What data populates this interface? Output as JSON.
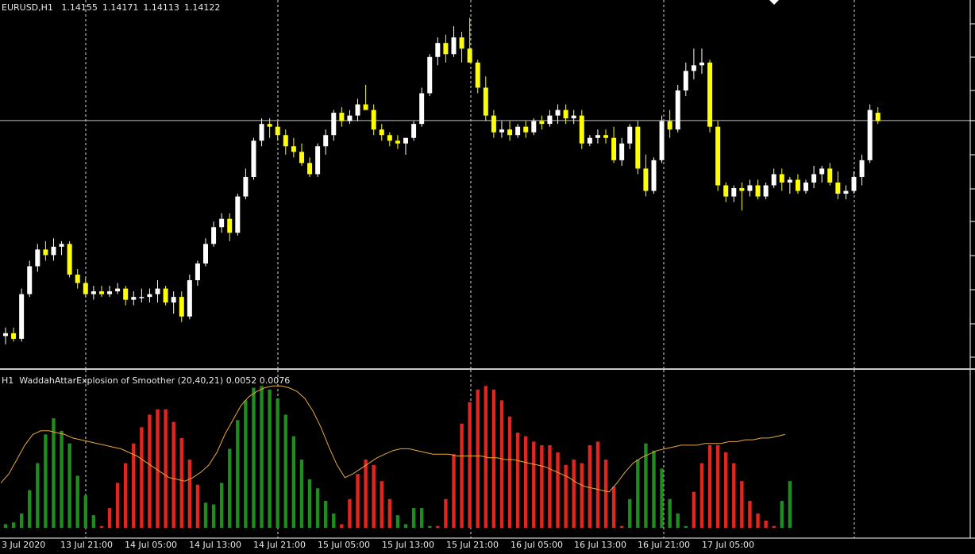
{
  "window": {
    "symbol": "EURUSD,H1",
    "open": "1.14155",
    "high": "1.14171",
    "low": "1.14113",
    "close": "1.14122"
  },
  "indicator": {
    "timeframe": "H1",
    "name": "WaddahAttarExplosion of Smoother (20,40,21)",
    "value1": "0.0052",
    "value2": "0.0076"
  },
  "colors": {
    "background": "#000000",
    "bull_candle": "#ffffff",
    "bear_candle": "#ffff00",
    "histogram_up": "#1e8c1e",
    "histogram_down": "#e0261e",
    "signal_line": "#e6a93a",
    "grid": "#ffffff",
    "bid_line": "#c0c0c0"
  },
  "time_axis": [
    "3 Jul 2020",
    "13 Jul 21:00",
    "14 Jul 05:00",
    "14 Jul 13:00",
    "14 Jul 21:00",
    "15 Jul 05:00",
    "15 Jul 13:00",
    "15 Jul 21:00",
    "16 Jul 05:00",
    "16 Jul 13:00",
    "16 Jul 21:00",
    "17 Jul 05:00"
  ],
  "chart_data": [
    {
      "type": "candlestick",
      "title": "EURUSD,H1",
      "grid": true,
      "bid_line": 1.14122,
      "ylim": [
        1.1326,
        1.1452
      ],
      "candles": [
        [
          1.1335,
          1.1338,
          1.1332,
          1.1336
        ],
        [
          1.1336,
          1.1338,
          1.1333,
          1.1334
        ],
        [
          1.1334,
          1.1352,
          1.1333,
          1.135
        ],
        [
          1.135,
          1.1362,
          1.1349,
          1.136
        ],
        [
          1.136,
          1.1368,
          1.1358,
          1.1366
        ],
        [
          1.1366,
          1.1369,
          1.1362,
          1.1364
        ],
        [
          1.1364,
          1.137,
          1.1362,
          1.1367
        ],
        [
          1.1367,
          1.1369,
          1.1364,
          1.1368
        ],
        [
          1.1368,
          1.1369,
          1.1356,
          1.1357
        ],
        [
          1.1357,
          1.1359,
          1.1352,
          1.1354
        ],
        [
          1.1354,
          1.1356,
          1.1349,
          1.135
        ],
        [
          1.135,
          1.1353,
          1.1348,
          1.1351
        ],
        [
          1.1351,
          1.1353,
          1.1349,
          1.135
        ],
        [
          1.135,
          1.1353,
          1.1349,
          1.1351
        ],
        [
          1.1351,
          1.1354,
          1.135,
          1.1352
        ],
        [
          1.1352,
          1.1353,
          1.1346,
          1.1348
        ],
        [
          1.1348,
          1.1351,
          1.1346,
          1.1349
        ],
        [
          1.1349,
          1.1352,
          1.1347,
          1.1349
        ],
        [
          1.1349,
          1.1352,
          1.1347,
          1.135
        ],
        [
          1.135,
          1.1355,
          1.1347,
          1.1352
        ],
        [
          1.1352,
          1.1353,
          1.1346,
          1.1347
        ],
        [
          1.1347,
          1.1351,
          1.1343,
          1.1349
        ],
        [
          1.1349,
          1.1351,
          1.134,
          1.1342
        ],
        [
          1.1342,
          1.1357,
          1.1341,
          1.1355
        ],
        [
          1.1355,
          1.1362,
          1.1353,
          1.1361
        ],
        [
          1.1361,
          1.137,
          1.136,
          1.1368
        ],
        [
          1.1368,
          1.1376,
          1.1367,
          1.1374
        ],
        [
          1.1374,
          1.1379,
          1.1372,
          1.1377
        ],
        [
          1.1377,
          1.1379,
          1.1369,
          1.1372
        ],
        [
          1.1372,
          1.1386,
          1.1371,
          1.1385
        ],
        [
          1.1385,
          1.1395,
          1.1384,
          1.1392
        ],
        [
          1.1392,
          1.1406,
          1.1391,
          1.1405
        ],
        [
          1.1405,
          1.1413,
          1.1403,
          1.1411
        ],
        [
          1.1411,
          1.1413,
          1.1406,
          1.141
        ],
        [
          1.141,
          1.1412,
          1.1405,
          1.1407
        ],
        [
          1.1407,
          1.1409,
          1.14,
          1.1403
        ],
        [
          1.1403,
          1.1406,
          1.1399,
          1.1401
        ],
        [
          1.1401,
          1.1404,
          1.1396,
          1.1397
        ],
        [
          1.1397,
          1.1399,
          1.1392,
          1.1393
        ],
        [
          1.1393,
          1.1404,
          1.1392,
          1.1403
        ],
        [
          1.1403,
          1.1409,
          1.14,
          1.1407
        ],
        [
          1.1407,
          1.1416,
          1.1405,
          1.1415
        ],
        [
          1.1415,
          1.1417,
          1.141,
          1.1412
        ],
        [
          1.1412,
          1.1416,
          1.1411,
          1.1414
        ],
        [
          1.1414,
          1.142,
          1.1412,
          1.1418
        ],
        [
          1.1418,
          1.1425,
          1.1416,
          1.1416
        ],
        [
          1.1416,
          1.1418,
          1.1407,
          1.1409
        ],
        [
          1.1409,
          1.1411,
          1.1405,
          1.1407
        ],
        [
          1.1407,
          1.1408,
          1.1403,
          1.1405
        ],
        [
          1.1405,
          1.1407,
          1.1402,
          1.1404
        ],
        [
          1.1404,
          1.1406,
          1.14,
          1.1406
        ],
        [
          1.1406,
          1.1412,
          1.1405,
          1.1411
        ],
        [
          1.1411,
          1.1424,
          1.141,
          1.1422
        ],
        [
          1.1422,
          1.1436,
          1.1421,
          1.1435
        ],
        [
          1.1435,
          1.1442,
          1.1432,
          1.144
        ],
        [
          1.144,
          1.1443,
          1.1433,
          1.1436
        ],
        [
          1.1436,
          1.1446,
          1.1435,
          1.1442
        ],
        [
          1.1442,
          1.1444,
          1.1433,
          1.1438
        ],
        [
          1.1438,
          1.1449,
          1.1434,
          1.1433
        ],
        [
          1.1433,
          1.1434,
          1.1422,
          1.1424
        ],
        [
          1.1424,
          1.1428,
          1.1412,
          1.1414
        ],
        [
          1.1414,
          1.1416,
          1.1406,
          1.1408
        ],
        [
          1.1408,
          1.1412,
          1.1406,
          1.1409
        ],
        [
          1.1409,
          1.1412,
          1.1405,
          1.1407
        ],
        [
          1.1407,
          1.1411,
          1.1406,
          1.141
        ],
        [
          1.141,
          1.1412,
          1.1406,
          1.1408
        ],
        [
          1.1408,
          1.1413,
          1.1407,
          1.1412
        ],
        [
          1.1412,
          1.1414,
          1.1409,
          1.1411
        ],
        [
          1.1411,
          1.1416,
          1.141,
          1.1414
        ],
        [
          1.1414,
          1.1418,
          1.1411,
          1.1416
        ],
        [
          1.1416,
          1.1418,
          1.1411,
          1.1413
        ],
        [
          1.1413,
          1.1416,
          1.1411,
          1.1414
        ],
        [
          1.1414,
          1.1416,
          1.1402,
          1.1404
        ],
        [
          1.1404,
          1.1407,
          1.1403,
          1.1406
        ],
        [
          1.1406,
          1.1409,
          1.1404,
          1.1407
        ],
        [
          1.1407,
          1.1409,
          1.1404,
          1.1406
        ],
        [
          1.1406,
          1.141,
          1.1397,
          1.1398
        ],
        [
          1.1398,
          1.1406,
          1.1396,
          1.1404
        ],
        [
          1.1404,
          1.1411,
          1.1402,
          1.141
        ],
        [
          1.141,
          1.1412,
          1.1393,
          1.1395
        ],
        [
          1.1395,
          1.14,
          1.1385,
          1.1387
        ],
        [
          1.1387,
          1.1399,
          1.1386,
          1.1398
        ],
        [
          1.1398,
          1.1414,
          1.1397,
          1.1412
        ],
        [
          1.1412,
          1.1416,
          1.1406,
          1.1409
        ],
        [
          1.1409,
          1.1425,
          1.1408,
          1.1423
        ],
        [
          1.1423,
          1.1433,
          1.1421,
          1.143
        ],
        [
          1.143,
          1.1438,
          1.1427,
          1.1432
        ],
        [
          1.1432,
          1.1438,
          1.1429,
          1.1433
        ],
        [
          1.1433,
          1.1434,
          1.1408,
          1.141
        ],
        [
          1.141,
          1.1412,
          1.1387,
          1.1389
        ],
        [
          1.1389,
          1.139,
          1.1383,
          1.1385
        ],
        [
          1.1385,
          1.1389,
          1.1383,
          1.1388
        ],
        [
          1.1388,
          1.139,
          1.138,
          1.1387
        ],
        [
          1.1387,
          1.1391,
          1.1385,
          1.1389
        ],
        [
          1.1389,
          1.1391,
          1.1384,
          1.1385
        ],
        [
          1.1385,
          1.139,
          1.1384,
          1.1389
        ],
        [
          1.1389,
          1.1395,
          1.1388,
          1.1393
        ],
        [
          1.1393,
          1.1395,
          1.1387,
          1.139
        ],
        [
          1.139,
          1.1392,
          1.1386,
          1.1391
        ],
        [
          1.1391,
          1.1393,
          1.1386,
          1.1387
        ],
        [
          1.1387,
          1.1391,
          1.1386,
          1.139
        ],
        [
          1.139,
          1.1396,
          1.1388,
          1.1393
        ],
        [
          1.1393,
          1.1396,
          1.139,
          1.1395
        ],
        [
          1.1395,
          1.1397,
          1.1389,
          1.139
        ],
        [
          1.139,
          1.1394,
          1.1384,
          1.1386
        ],
        [
          1.1386,
          1.1389,
          1.1384,
          1.1387
        ],
        [
          1.1387,
          1.1394,
          1.1386,
          1.1392
        ],
        [
          1.1392,
          1.14,
          1.1389,
          1.1398
        ],
        [
          1.1398,
          1.1418,
          1.1397,
          1.1416
        ],
        [
          1.1415,
          1.1417,
          1.1411,
          1.1412
        ]
      ]
    },
    {
      "type": "bar",
      "title": "WaddahAttarExplosion of Smoother (20,40,21)",
      "series": [
        {
          "values": [
            0.0002,
            0.0003,
            0.0008,
            0.0021,
            0.0036,
            0.0052,
            0.0061,
            0.0054,
            0.0047,
            0.0029,
            0.0018,
            0.0007,
            0.0001,
            0.0011,
            0.0025,
            0.0036,
            0.0047,
            0.0056,
            0.0063,
            0.0066,
            0.0066,
            0.0059,
            0.005,
            0.0038,
            0.0024,
            0.0014,
            0.0013,
            0.0025,
            0.0044,
            0.006,
            0.0071,
            0.0078,
            0.0079,
            0.0077,
            0.0072,
            0.0063,
            0.0051,
            0.0038,
            0.0027,
            0.0022,
            0.0015,
            0.0008,
            0.0002,
            0.0016,
            0.003,
            0.0038,
            0.0035,
            0.0026,
            0.0016,
            0.0007,
            0.0002,
            0.0011,
            0.0011,
            0.0001,
            0.0001,
            0.0016,
            0.0041,
            0.0058,
            0.007,
            0.0077,
            0.0079,
            0.0077,
            0.0071,
            0.0062,
            0.0053,
            0.0051,
            0.0048,
            0.0046,
            0.0046,
            0.0042,
            0.0035,
            0.0038,
            0.0036,
            0.0046,
            0.0048,
            0.0038,
            0.0023,
            0.0001,
            0.0016,
            0.0038,
            0.0047,
            0.0043,
            0.0033,
            0.0016,
            0.0008,
            0.0001,
            0.002,
            0.0036,
            0.0046,
            0.0046,
            0.0042,
            0.0036,
            0.0026,
            0.0015,
            0.0008,
            0.0004,
            0.0001,
            0.0015,
            0.0026
          ],
          "colors": [
            "g",
            "g",
            "g",
            "g",
            "g",
            "g",
            "g",
            "g",
            "g",
            "g",
            "g",
            "g",
            "r",
            "r",
            "r",
            "r",
            "r",
            "r",
            "r",
            "r",
            "r",
            "r",
            "r",
            "r",
            "r",
            "g",
            "g",
            "g",
            "g",
            "g",
            "g",
            "g",
            "g",
            "g",
            "g",
            "g",
            "g",
            "g",
            "g",
            "g",
            "g",
            "g",
            "r",
            "r",
            "r",
            "r",
            "r",
            "r",
            "r",
            "g",
            "g",
            "g",
            "g",
            "g",
            "r",
            "r",
            "r",
            "r",
            "r",
            "r",
            "r",
            "r",
            "r",
            "r",
            "r",
            "r",
            "r",
            "r",
            "r",
            "r",
            "r",
            "r",
            "r",
            "r",
            "r",
            "r",
            "r",
            "r",
            "g",
            "g",
            "g",
            "g",
            "g",
            "g",
            "g",
            "g",
            "r",
            "r",
            "r",
            "r",
            "r",
            "r",
            "r",
            "r",
            "r",
            "r",
            "r",
            "g",
            "g"
          ]
        }
      ],
      "signal_line": [
        0.0025,
        0.003,
        0.0038,
        0.0046,
        0.0052,
        0.0054,
        0.0054,
        0.0053,
        0.0052,
        0.005,
        0.0049,
        0.0048,
        0.0047,
        0.0046,
        0.0045,
        0.0044,
        0.0042,
        0.004,
        0.0037,
        0.0034,
        0.0031,
        0.0028,
        0.0027,
        0.0026,
        0.0028,
        0.0031,
        0.0035,
        0.0042,
        0.0052,
        0.006,
        0.0068,
        0.0073,
        0.0076,
        0.0078,
        0.0079,
        0.0079,
        0.0078,
        0.0076,
        0.0072,
        0.0065,
        0.0056,
        0.0045,
        0.0035,
        0.0028,
        0.003,
        0.0033,
        0.0036,
        0.0039,
        0.0041,
        0.0043,
        0.0044,
        0.0044,
        0.0043,
        0.0042,
        0.0041,
        0.0041,
        0.0041,
        0.004,
        0.004,
        0.004,
        0.004,
        0.0039,
        0.0039,
        0.0038,
        0.0038,
        0.0037,
        0.0036,
        0.0035,
        0.0034,
        0.0032,
        0.003,
        0.0028,
        0.0025,
        0.0023,
        0.0022,
        0.0021,
        0.002,
        0.0025,
        0.0031,
        0.0036,
        0.0039,
        0.0041,
        0.0043,
        0.0044,
        0.0045,
        0.0046,
        0.0046,
        0.0046,
        0.0047,
        0.0047,
        0.0047,
        0.0048,
        0.0048,
        0.0049,
        0.0049,
        0.005,
        0.005,
        0.0051,
        0.0052
      ]
    }
  ]
}
